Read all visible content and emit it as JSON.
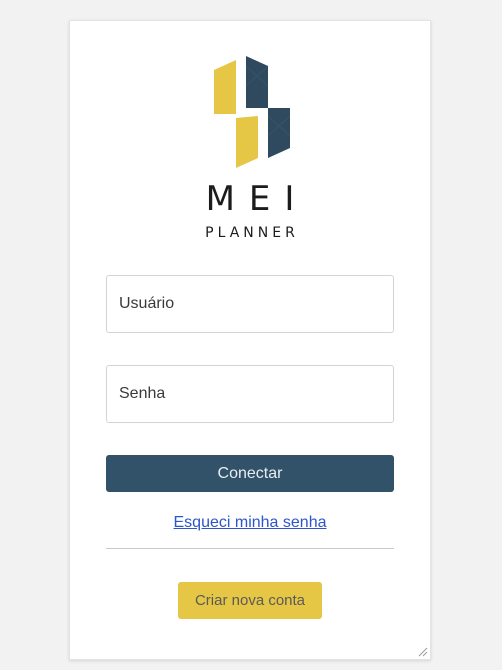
{
  "logo": {
    "title": "MEI",
    "subtitle": "PLANNER",
    "colors": {
      "yellow": "#e6c645",
      "navy": "#2f4a5f"
    }
  },
  "form": {
    "username_placeholder": "Usuário",
    "password_placeholder": "Senha",
    "submit_label": "Conectar",
    "forgot_label": "Esqueci minha senha",
    "create_label": "Criar nova conta"
  },
  "colors": {
    "primary": "#32526a",
    "secondary": "#e6c645",
    "secondary_text": "#5a5a5a",
    "link": "#2c56c9"
  }
}
